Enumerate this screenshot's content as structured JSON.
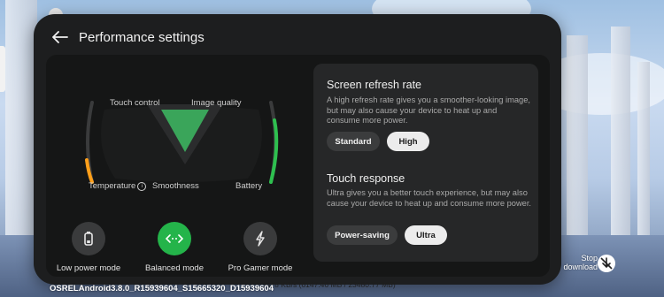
{
  "header": {
    "title": "Performance settings"
  },
  "gauge": {
    "labels": {
      "touch_control": "Touch control",
      "image_quality": "Image quality",
      "temperature": "Temperature",
      "smoothness": "Smoothness",
      "battery": "Battery"
    },
    "temperature_color": "#ff9f1a",
    "battery_color": "#2ec04f",
    "triangle_color": "#3aa55a"
  },
  "modes": [
    {
      "label": "Low power mode",
      "icon": "battery-icon",
      "active": false
    },
    {
      "label": "Balanced mode",
      "icon": "balanced-arrows-icon",
      "active": true
    },
    {
      "label": "Pro Gamer mode",
      "icon": "lightning-icon",
      "active": false
    }
  ],
  "refresh": {
    "title": "Screen refresh rate",
    "description": "A high refresh rate gives you a smoother-looking image, but may also cause your device to heat up and consume more power.",
    "options": [
      "Standard",
      "High"
    ],
    "selected": "High"
  },
  "touch": {
    "title": "Touch response",
    "description": "Ultra gives you a better touch experience, but may also cause your device to heat up and consume more power.",
    "options": [
      "Power-saving",
      "Ultra"
    ],
    "selected": "Ultra"
  },
  "overlay": {
    "build": "OSRELAndroid3.8.0_R15939604_S15665320_D15939604",
    "speed": "3478 KB/s (6147.46 MB / 23480.77 MB)",
    "stop_download": "Stop\ndownload"
  }
}
